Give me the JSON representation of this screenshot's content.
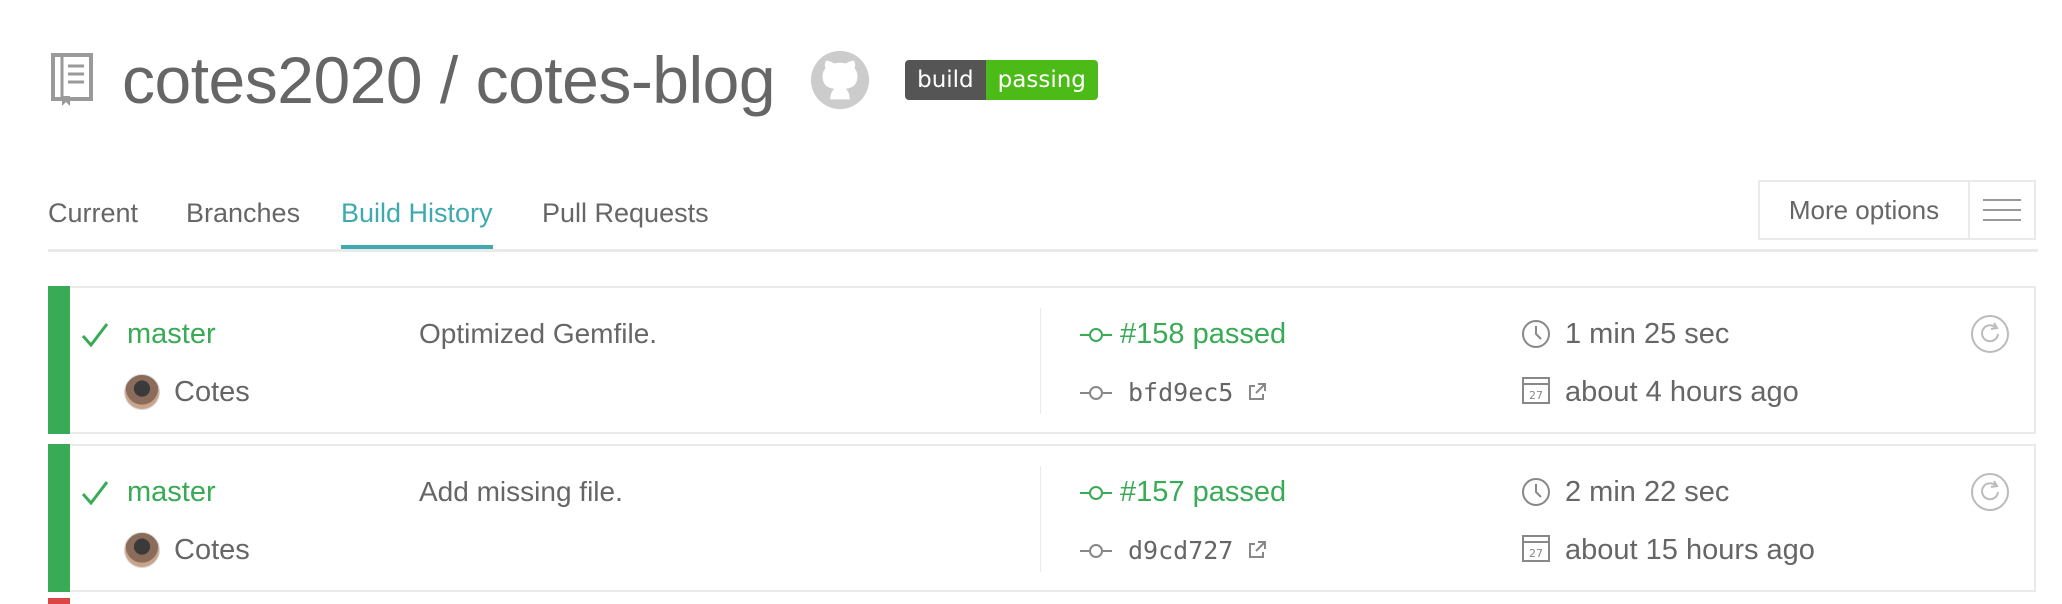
{
  "repo": {
    "title": "cotes2020 / cotes-blog",
    "badge": {
      "left": "build",
      "right": "passing"
    }
  },
  "icons": {
    "repo": "repo-book-icon",
    "github": "github-icon",
    "menu": "hamburger-menu-icon",
    "check": "check-icon",
    "commit": "commit-icon",
    "external": "external-link-icon",
    "clock": "clock-icon",
    "calendar": "calendar-icon",
    "restart": "restart-icon"
  },
  "tabs": [
    {
      "label": "Current",
      "active": false
    },
    {
      "label": "Branches",
      "active": false
    },
    {
      "label": "Build History",
      "active": true
    },
    {
      "label": "Pull Requests",
      "active": false
    }
  ],
  "more_options": {
    "label": "More options"
  },
  "builds": [
    {
      "status": "passed",
      "branch": "master",
      "author": "Cotes",
      "message": "Optimized Gemfile.",
      "number": "#158 passed",
      "sha": "bfd9ec5",
      "duration": "1 min 25 sec",
      "finished": "about 4 hours ago",
      "calendar_day": "27"
    },
    {
      "status": "passed",
      "branch": "master",
      "author": "Cotes",
      "message": "Add missing file.",
      "number": "#157 passed",
      "sha": "d9cd727",
      "duration": "2 min 22 sec",
      "finished": "about 15 hours ago",
      "calendar_day": "27"
    }
  ],
  "colors": {
    "passed": "#39aa56",
    "failed": "#db4545",
    "accent": "#3eaaaf",
    "text": "#666666",
    "badge_dark": "#555555",
    "badge_green": "#4cbb17"
  }
}
